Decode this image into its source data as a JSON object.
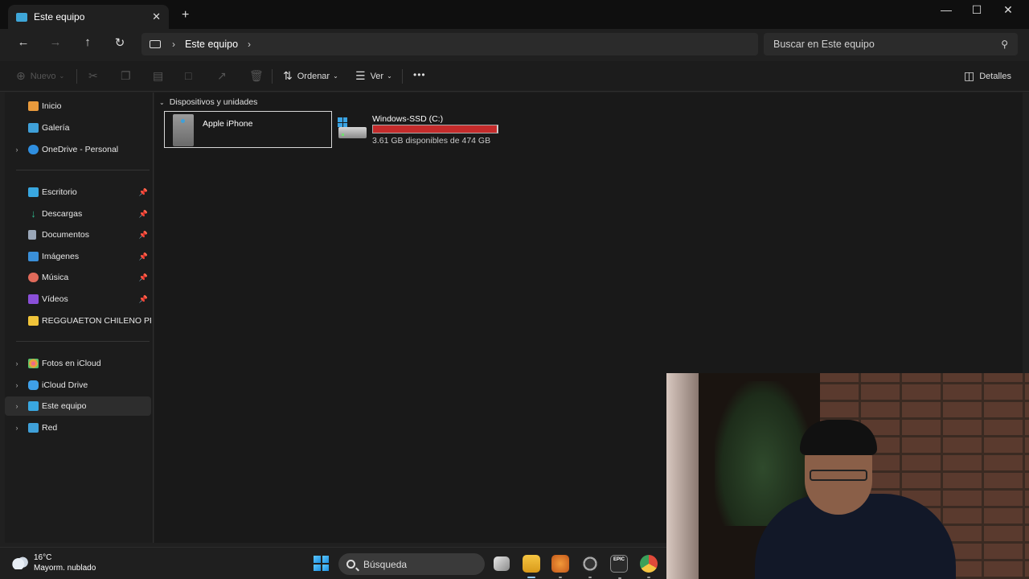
{
  "window": {
    "tab_title": "Este equipo",
    "new_tab": "+",
    "tab_close": "✕",
    "minimize": "—",
    "maximize": "☐",
    "close": "✕"
  },
  "address": {
    "location": "Este equipo",
    "search_placeholder": "Buscar en Este equipo"
  },
  "toolbar": {
    "new_label": "Nuevo",
    "sort_label": "Ordenar",
    "view_label": "Ver",
    "more_label": "•••",
    "details_label": "Detalles"
  },
  "sidebar": {
    "quick": [
      {
        "label": "Inicio",
        "icon": "home-icon",
        "color": "#e89a3c"
      },
      {
        "label": "Galería",
        "icon": "gallery-icon",
        "color": "#3fa0d8"
      },
      {
        "label": "OneDrive - Personal",
        "icon": "onedrive-icon",
        "color": "#2f8fe0"
      }
    ],
    "pinned": [
      {
        "label": "Escritorio",
        "icon": "desktop-icon",
        "color": "#39a7e0"
      },
      {
        "label": "Descargas",
        "icon": "download-icon",
        "color": "#2fb58a"
      },
      {
        "label": "Documentos",
        "icon": "documents-icon",
        "color": "#9aa7b8"
      },
      {
        "label": "Imágenes",
        "icon": "pictures-icon",
        "color": "#3a8fd8"
      },
      {
        "label": "Música",
        "icon": "music-icon",
        "color": "#e06a5a"
      },
      {
        "label": "Vídeos",
        "icon": "videos-icon",
        "color": "#8a4fd8"
      },
      {
        "label": "REGGUAETON CHILENO PROD",
        "icon": "folder-icon",
        "color": "#f0c43a"
      }
    ],
    "locations": [
      {
        "label": "Fotos en iCloud",
        "icon": "icloud-photos-icon",
        "color": "#e8a03a"
      },
      {
        "label": "iCloud Drive",
        "icon": "icloud-drive-icon",
        "color": "#3fa0e8"
      },
      {
        "label": "Este equipo",
        "icon": "this-pc-icon",
        "color": "#39a7e0"
      },
      {
        "label": "Red",
        "icon": "network-icon",
        "color": "#3fa0d8"
      }
    ]
  },
  "main": {
    "group_title": "Dispositivos y unidades",
    "device_label": "Apple iPhone",
    "drive_name": "Windows-SSD (C:)",
    "drive_free": "3.61 GB disponibles de 474 GB",
    "drive_used_fraction": 0.992,
    "drive_bar_color": "#c42b2b"
  },
  "taskbar": {
    "temperature": "16°C",
    "weather": "Mayorm. nublado",
    "search_label": "Búsqueda"
  }
}
